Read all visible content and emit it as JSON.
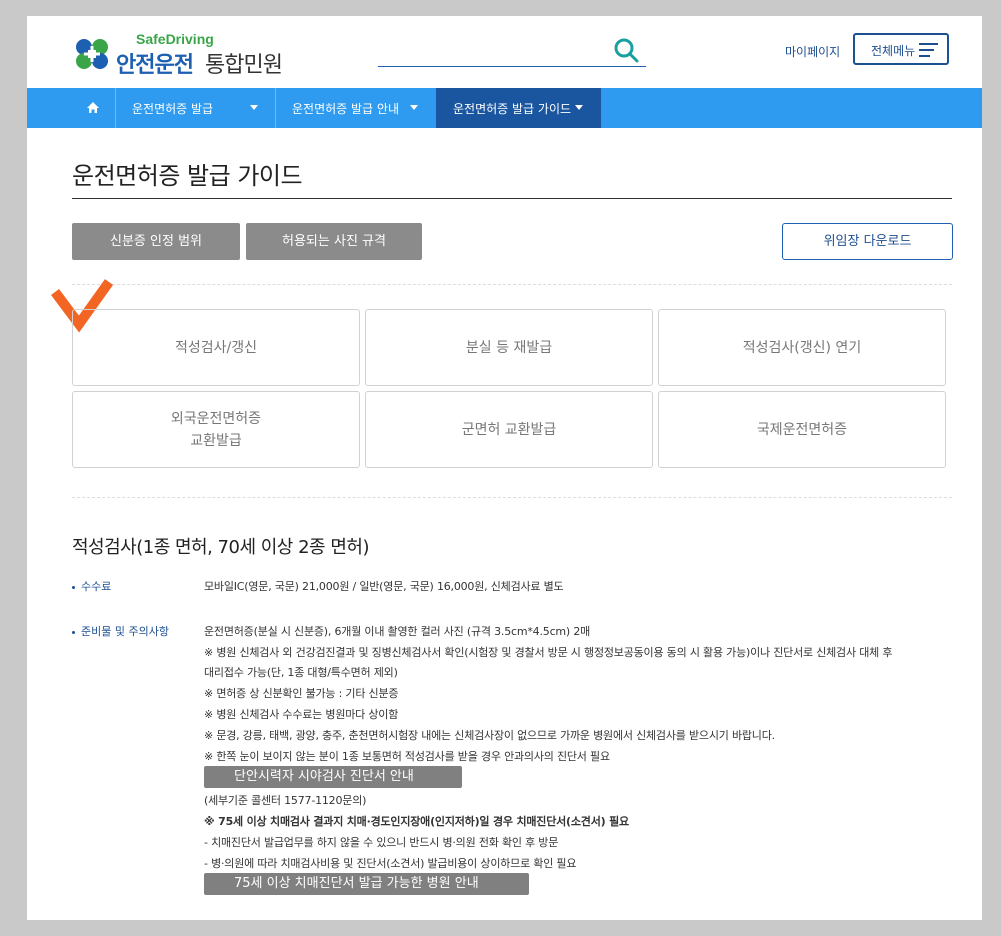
{
  "header": {
    "logo_en": "SafeDriving",
    "logo_kr_main": "안전운전",
    "logo_kr_sub": "통합민원",
    "search_placeholder": "",
    "mypage": "마이페이지",
    "allmenu": "전체메뉴"
  },
  "nav": {
    "items": [
      {
        "label": "운전면허증 발급"
      },
      {
        "label": "운전면허증 발급 안내"
      },
      {
        "label": "운전면허증 발급 가이드"
      }
    ]
  },
  "page": {
    "title": "운전면허증 발급 가이드",
    "btn_id_scope": "신분증 인정 범위",
    "btn_photo": "허용되는 사진 규격",
    "btn_proxy": "위임장 다운로드"
  },
  "grid": {
    "items": [
      {
        "label": "적성검사/갱신"
      },
      {
        "label": "분실 등 재발급"
      },
      {
        "label": "적성검사(갱신) 연기"
      },
      {
        "label1": "외국운전면허증",
        "label2": "교환발급"
      },
      {
        "label": "군면허 교환발급"
      },
      {
        "label": "국제운전면허증"
      }
    ]
  },
  "section": {
    "title": "적성검사(1종 면허, 70세 이상 2종 면허)",
    "fee_label": "수수료",
    "fee_text": "모바일IC(영문, 국문) 21,000원 / 일반(영문, 국문) 16,000원, 신체검사료 별도",
    "prep_label": "준비물 및 주의사항",
    "lines": [
      "운전면허증(분실 시 신분증), 6개월 이내 촬영한 컬러 사진 (규격 3.5cm*4.5cm) 2매",
      "※ 병원 신체검사 외 건강검진결과 및 징병신체검사서 확인(시험장 및 경찰서 방문 시 행정정보공동이용 동의 시 활용 가능)이나 진단서로 신체검사 대체 후",
      "대리접수 가능(단, 1종 대형/특수면허 제외)",
      "※ 면허증 상 신분확인 불가능 : 기타 신분증",
      "※ 병원 신체검사 수수료는 병원마다 상이함",
      "※ 문경, 강릉, 태백, 광양, 충주, 춘천면허시험장 내에는 신체검사장이 없으므로 가까운 병원에서 신체검사를 받으시기 바랍니다.",
      "※ 한쪽 눈이 보이지 않는 분이 1종 보통면허 적성검사를 받을 경우 안과의사의 진단서 필요"
    ],
    "btn_vision": "단안시력자 시야검사 진단서 안내",
    "callcenter": "(세부기준 콜센터 1577-1120문의)",
    "dementia_notice": "※ 75세 이상 치매검사 결과지 치매·경도인지장애(인지저하)일 경우 치매진단서(소견서) 필요",
    "dementia_line1": "- 치매진단서 발급업무를 하지 않을 수 있으니 반드시 병·의원 전화 확인 후 방문",
    "dementia_line2": "- 병·의원에 따라 치매검사비용 및 진단서(소견서) 발급비용이 상이하므로 확인 필요",
    "btn_hospital": "75세 이상 치매진단서 발급 가능한 병원 안내"
  },
  "colors": {
    "primary": "#1d4f91",
    "nav": "#2e9bf0",
    "nav_active": "#1a56a0",
    "accent": "#f26522",
    "button_gray": "#8b8b8b"
  }
}
